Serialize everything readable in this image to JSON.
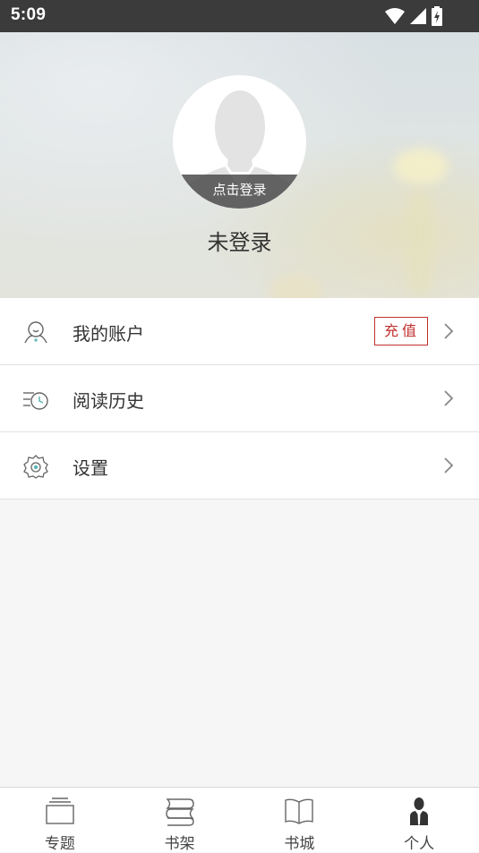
{
  "status_bar": {
    "time": "5:09",
    "icons": [
      "wifi-icon",
      "signal-icon",
      "battery-charging-icon"
    ]
  },
  "profile": {
    "avatar_label": "点击登录",
    "username": "未登录"
  },
  "menu": {
    "items": [
      {
        "label": "我的账户",
        "icon": "account-icon",
        "badge": "充值"
      },
      {
        "label": "阅读历史",
        "icon": "history-icon"
      },
      {
        "label": "设置",
        "icon": "settings-icon"
      }
    ]
  },
  "tabbar": {
    "tabs": [
      {
        "label": "专题",
        "icon": "topics-icon",
        "active": false
      },
      {
        "label": "书架",
        "icon": "bookshelf-icon",
        "active": false
      },
      {
        "label": "书城",
        "icon": "bookstore-icon",
        "active": false
      },
      {
        "label": "个人",
        "icon": "profile-icon",
        "active": true
      }
    ]
  },
  "colors": {
    "status_bar": "#3b3b3b",
    "accent_red": "#c0302e",
    "page_background": "#f6f6f7",
    "icon_teal": "#5bb7b4"
  }
}
